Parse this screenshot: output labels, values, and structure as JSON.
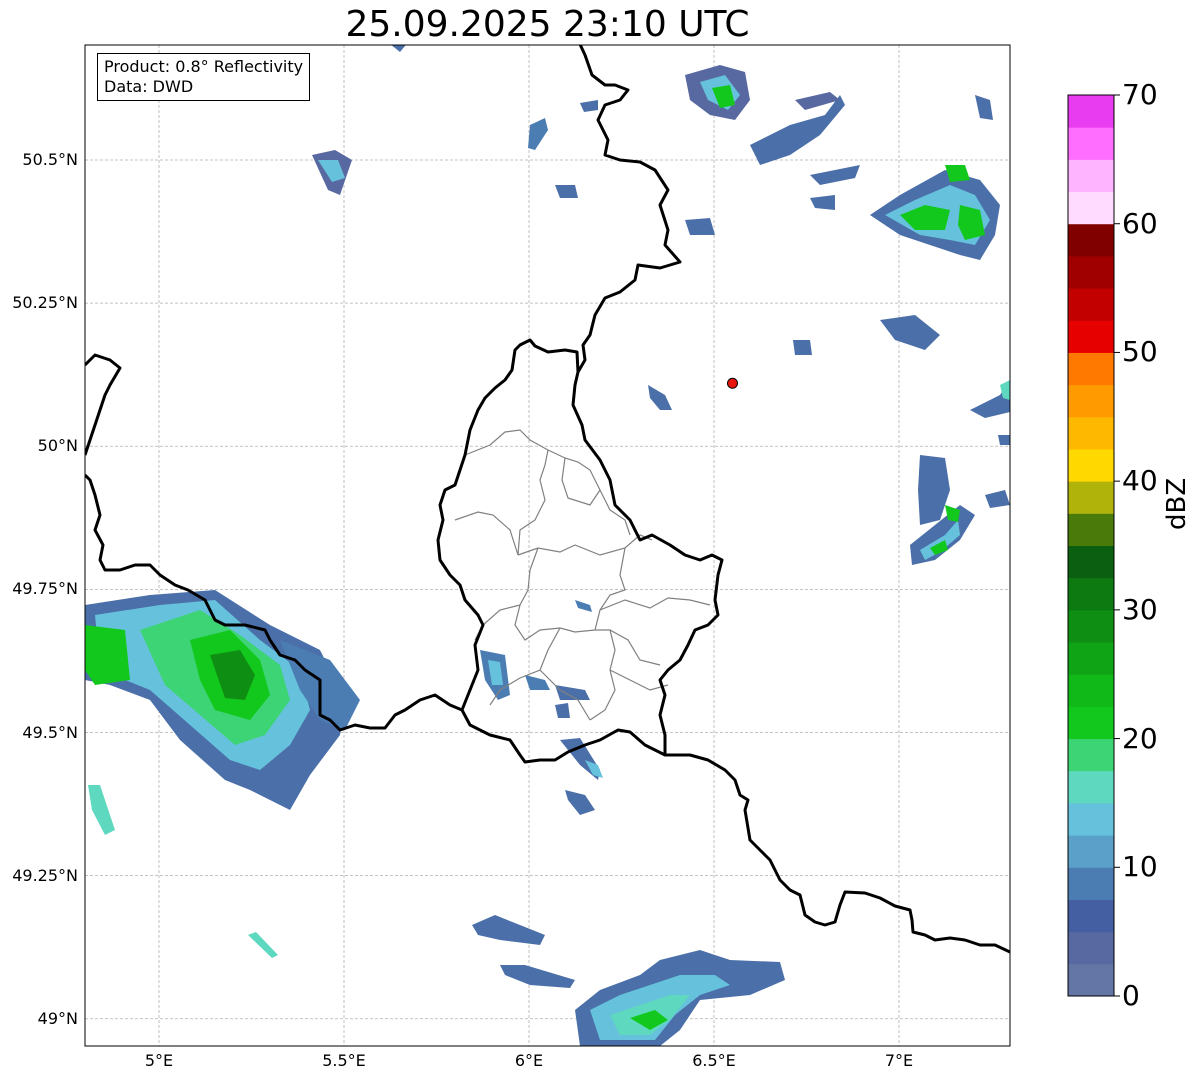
{
  "title": "25.09.2025 23:10 UTC",
  "info": {
    "product_line": "Product: 0.8° Reflectivity",
    "data_line": "Data: DWD"
  },
  "axes": {
    "lon_ticks": [
      {
        "value": 5.0,
        "label": "5°E"
      },
      {
        "value": 5.5,
        "label": "5.5°E"
      },
      {
        "value": 6.0,
        "label": "6°E"
      },
      {
        "value": 6.5,
        "label": "6.5°E"
      },
      {
        "value": 7.0,
        "label": "7°E"
      }
    ],
    "lat_ticks": [
      {
        "value": 50.5,
        "label": "50.5°N"
      },
      {
        "value": 50.25,
        "label": "50.25°N"
      },
      {
        "value": 50.0,
        "label": "50°N"
      },
      {
        "value": 49.75,
        "label": "49.75°N"
      },
      {
        "value": 49.5,
        "label": "49.5°N"
      },
      {
        "value": 49.25,
        "label": "49.25°N"
      },
      {
        "value": 49.0,
        "label": "49°N"
      }
    ],
    "lon_range": [
      4.8,
      7.3
    ],
    "lat_range": [
      48.95,
      50.7
    ],
    "grid": true
  },
  "radar_site": {
    "lon": 6.55,
    "lat": 50.11,
    "color": "#e8160c"
  },
  "colorbar": {
    "label": "dBZ",
    "ticks": [
      "0",
      "10",
      "20",
      "30",
      "40",
      "50",
      "60",
      "70"
    ],
    "colors": [
      "#6476a6",
      "#5868a0",
      "#455fa3",
      "#4b7db3",
      "#5ba0c8",
      "#66c1dc",
      "#5fd8c0",
      "#3cd474",
      "#12c81c",
      "#10b818",
      "#0fa416",
      "#0e8f13",
      "#0c7a10",
      "#0a6010",
      "#4a7a0a",
      "#b0b30a",
      "#ffd800",
      "#ffb800",
      "#ff9a00",
      "#ff7800",
      "#e60000",
      "#c20000",
      "#a00000",
      "#800000",
      "#ffdcff",
      "#ffb4ff",
      "#ff6eff",
      "#e83cf0"
    ]
  },
  "legend_colors": {
    "country_border": "#000000",
    "canton_border": "#808080",
    "gridline": "#b0b0b0"
  },
  "echo_cells": [
    {
      "lon": 5.13,
      "lat": 49.62,
      "intensity": "moderate"
    },
    {
      "lon": 4.95,
      "lat": 49.68,
      "intensity": "moderate"
    },
    {
      "lon": 5.4,
      "lat": 49.58,
      "intensity": "light"
    },
    {
      "lon": 6.35,
      "lat": 48.98,
      "intensity": "moderate"
    },
    {
      "lon": 7.07,
      "lat": 50.39,
      "intensity": "moderate"
    },
    {
      "lon": 6.5,
      "lat": 50.62,
      "intensity": "moderate"
    },
    {
      "lon": 7.1,
      "lat": 49.85,
      "intensity": "light"
    },
    {
      "lon": 5.5,
      "lat": 50.48,
      "intensity": "light"
    },
    {
      "lon": 5.95,
      "lat": 49.13,
      "intensity": "light"
    },
    {
      "lon": 7.25,
      "lat": 50.1,
      "intensity": "light"
    }
  ]
}
